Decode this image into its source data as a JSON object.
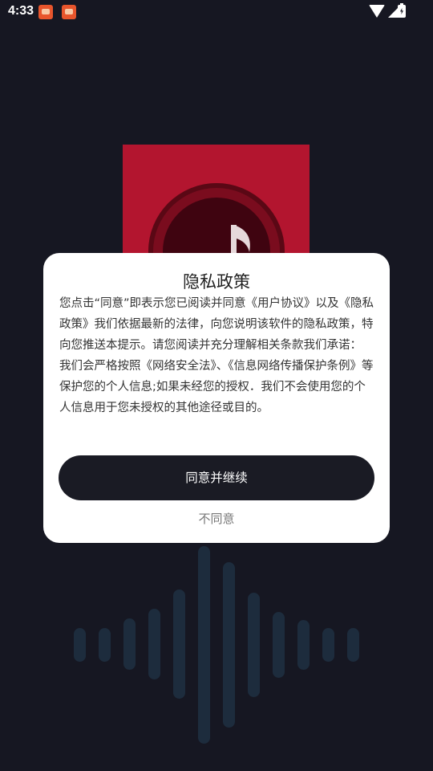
{
  "status_bar": {
    "time": "4:33",
    "notification_icons": [
      "game-notification-icon",
      "game-notification-icon"
    ],
    "system_icons": [
      "wifi-icon",
      "signal-icon",
      "battery-charging-icon"
    ]
  },
  "logo": {
    "icon": "music-note-icon",
    "background_color": "#b3152f"
  },
  "dialog": {
    "title": "隐私政策",
    "paragraphs": [
      "您点击“同意”即表示您已阅读并同意《用户协议》以及《隐私政策》我们依据最新的法律，向您说明该软件的隐私政策，特向您推送本提示。请您阅读并充分理解相关条款我们承诺：",
      "我们会严格按照《网络安全法》、《信息网络传播保护条例》等保护您的个人信息;如果未经您的授权．我们不会使用您的个人信息用于您未授权的其他途径或目的。"
    ],
    "agree_label": "同意并继续",
    "disagree_label": "不同意"
  },
  "colors": {
    "background": "#161722",
    "dialog": "#ffffff",
    "primary_button": "#1a1b24",
    "waveform": "#1d2c3d"
  }
}
